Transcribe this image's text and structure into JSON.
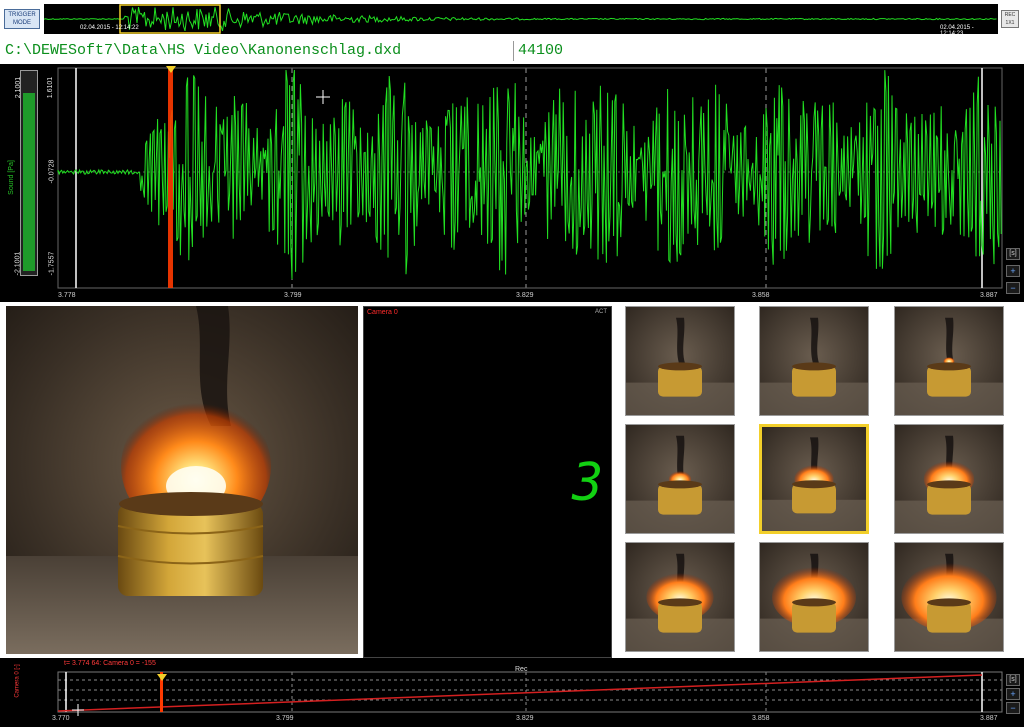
{
  "overview": {
    "trigger_label_1": "TRIGGER",
    "trigger_label_2": "MODE",
    "start_time": "02.04.2015 - 12:14:22",
    "end_time": "02.04.2015 - 12:14:23",
    "right_button": "REC 1X1"
  },
  "file": {
    "path": "C:\\DEWESoft7\\Data\\HS Video\\Kanonenschlag.dxd",
    "rate": "44100"
  },
  "sound": {
    "axis_label": "Sound [Pa]",
    "level_top": "2.1001",
    "level_bottom": "-2.1001",
    "y_max": "1.6101",
    "y_mid": "-0.0728",
    "y_min": "-1.7557",
    "x_ticks": [
      "3.778",
      "3.799",
      "3.829",
      "3.858",
      "3.887"
    ],
    "unit_box": "[s]",
    "zoom_in_icon": "plus-icon",
    "zoom_out_icon": "minus-icon",
    "colors": {
      "trace": "#22e022",
      "trigger": "#ff3a00"
    }
  },
  "camera": {
    "title": "Camera 0",
    "act": "ACT",
    "digit": "3"
  },
  "thumbnails": {
    "selected_index": 4,
    "count": 9
  },
  "timeline": {
    "info": "t= 3.774 64: Camera 0 = -155",
    "rec_label": "Rec",
    "y_label": "Camera 0 [-]",
    "x_ticks": [
      "3.770",
      "3.799",
      "3.829",
      "3.858",
      "3.887"
    ],
    "unit_box": "[s]",
    "zoom_in_icon": "plus-icon",
    "zoom_out_icon": "minus-icon"
  }
}
